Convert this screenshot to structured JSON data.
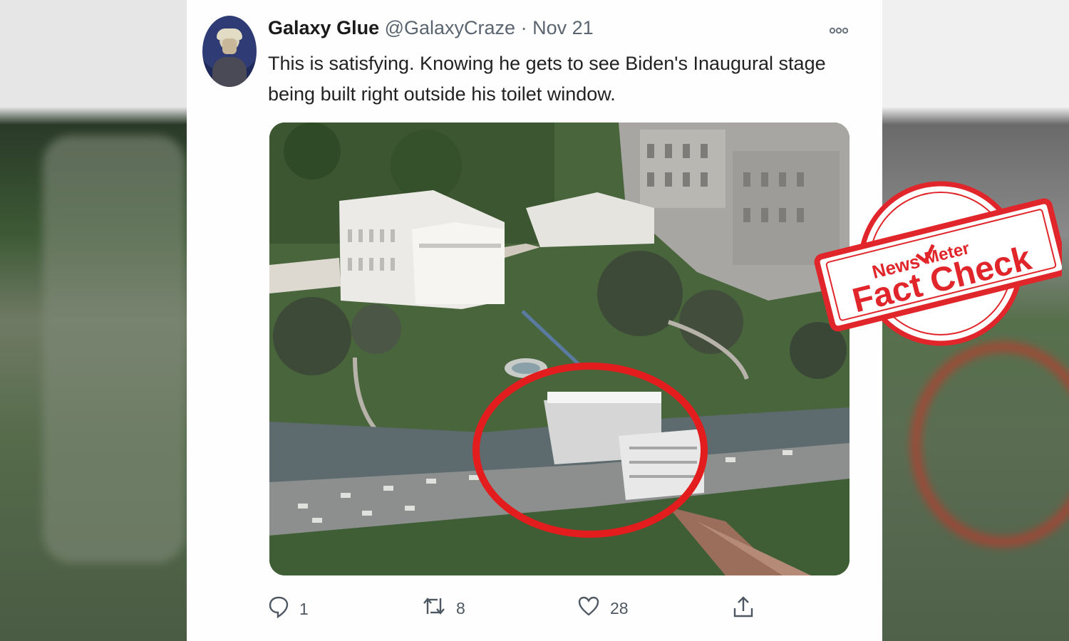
{
  "tweet": {
    "display_name": "Galaxy Glue",
    "handle": "@GalaxyCraze",
    "separator": "·",
    "date": "Nov 21",
    "more_icon": "more-dots-icon",
    "text": "This is satisfying. Knowing he gets to see Biden's Inaugural stage being built right outside his toilet window.",
    "image_alt": "Aerial view of the White House with inaugural stage construction circled in red",
    "actions": {
      "reply_icon": "reply-icon",
      "reply_count": "1",
      "retweet_icon": "retweet-icon",
      "retweet_count": "8",
      "like_icon": "heart-icon",
      "like_count": "28",
      "share_icon": "share-icon"
    }
  },
  "stamp": {
    "brand_news": "News",
    "brand_meter": "Meter",
    "label": "Fact Check",
    "color": "#e0262b"
  }
}
